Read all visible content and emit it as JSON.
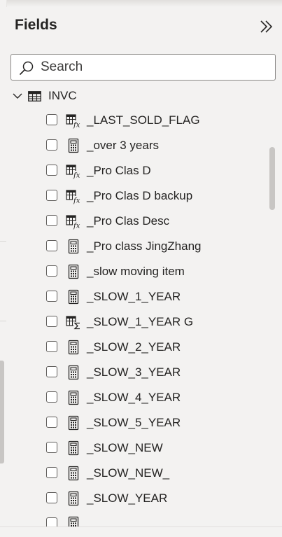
{
  "panel": {
    "title": "Fields"
  },
  "search": {
    "placeholder": "Search",
    "value": ""
  },
  "table": {
    "name": "INVC",
    "expanded": true
  },
  "fields": [
    {
      "label": "_LAST_SOLD_FLAG",
      "icon": "calculated-column-icon"
    },
    {
      "label": "_over 3 years",
      "icon": "measure-calculator-icon"
    },
    {
      "label": "_Pro Clas D",
      "icon": "calculated-column-icon"
    },
    {
      "label": "_Pro Clas D backup",
      "icon": "calculated-column-icon"
    },
    {
      "label": "_Pro Clas Desc",
      "icon": "calculated-column-icon"
    },
    {
      "label": "_Pro class JingZhang",
      "icon": "measure-calculator-icon"
    },
    {
      "label": "_slow moving item",
      "icon": "measure-calculator-icon"
    },
    {
      "label": "_SLOW_1_YEAR",
      "icon": "measure-calculator-icon"
    },
    {
      "label": "_SLOW_1_YEAR G",
      "icon": "sum-column-icon"
    },
    {
      "label": "_SLOW_2_YEAR",
      "icon": "measure-calculator-icon"
    },
    {
      "label": "_SLOW_3_YEAR",
      "icon": "measure-calculator-icon"
    },
    {
      "label": "_SLOW_4_YEAR",
      "icon": "measure-calculator-icon"
    },
    {
      "label": "_SLOW_5_YEAR",
      "icon": "measure-calculator-icon"
    },
    {
      "label": "_SLOW_NEW",
      "icon": "measure-calculator-icon"
    },
    {
      "label": "_SLOW_NEW_",
      "icon": "measure-calculator-icon"
    },
    {
      "label": "_SLOW_YEAR",
      "icon": "measure-calculator-icon"
    },
    {
      "label": "",
      "icon": "measure-calculator-icon"
    }
  ]
}
